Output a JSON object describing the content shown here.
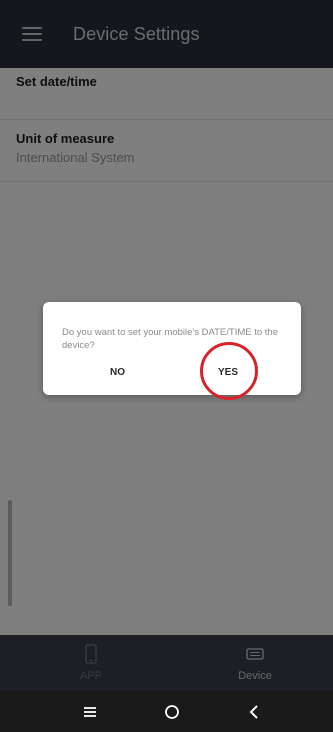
{
  "app_bar": {
    "title": "Device Settings",
    "menu_icon": "hamburger-icon"
  },
  "settings": [
    {
      "title": "Set date/time",
      "subtitle": ""
    },
    {
      "title": "Unit of measure",
      "subtitle": "International System"
    }
  ],
  "bottom_nav": {
    "items": [
      {
        "label": "APP",
        "icon": "phone-icon",
        "active": false
      },
      {
        "label": "Device",
        "icon": "device-icon",
        "active": true
      }
    ]
  },
  "dialog": {
    "message": "Do you want to set your mobile's DATE/TIME to the device?",
    "no_label": "NO",
    "yes_label": "YES",
    "highlight_color": "#d8222a"
  },
  "system_nav": {
    "buttons": [
      "menu-icon",
      "home-icon",
      "back-icon"
    ]
  }
}
